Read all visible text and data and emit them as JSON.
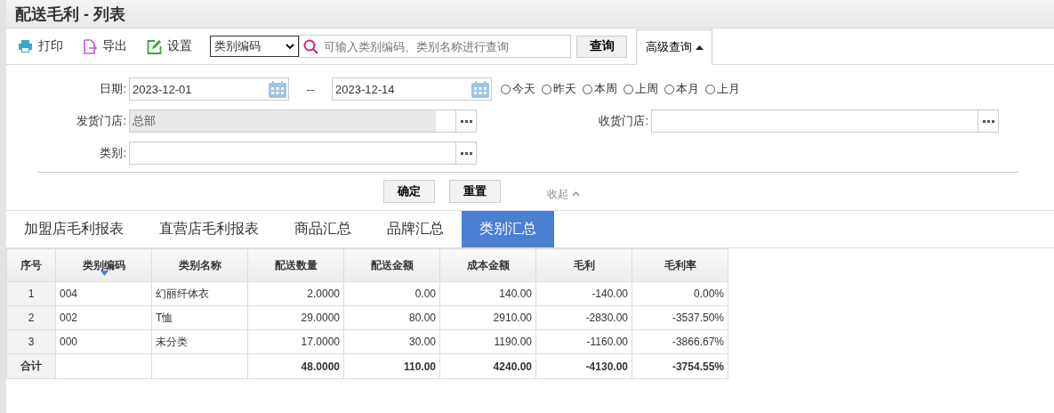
{
  "title": "配送毛利 - 列表",
  "toolbar": {
    "actions": [
      {
        "kind": "print",
        "label": "打印"
      },
      {
        "kind": "export",
        "label": "导出"
      },
      {
        "kind": "settings",
        "label": "设置"
      }
    ],
    "search_type": "类别编码",
    "search": {
      "placeholder": "可输入类别编码、类别名称进行查询"
    },
    "search_button": "查询",
    "advanced": {
      "label": "高级查询",
      "expanded": true
    }
  },
  "filters": {
    "date": {
      "label": "日期:",
      "from": "2023-12-01",
      "separator": "--",
      "to": "2023-12-14"
    },
    "quick_dates": [
      {
        "label": "今天",
        "selected": false
      },
      {
        "label": "昨天",
        "selected": false
      },
      {
        "label": "本周",
        "selected": false
      },
      {
        "label": "上周",
        "selected": false
      },
      {
        "label": "本月",
        "selected": false
      },
      {
        "label": "上月",
        "selected": false
      }
    ],
    "ship_store": {
      "label": "发货门店:",
      "value": "总部",
      "disabled": true
    },
    "receive_store": {
      "label": "收货门店:",
      "disabled": false
    },
    "category": {
      "label": "类别:",
      "disabled": false
    },
    "buttons": [
      "确定",
      "重置"
    ],
    "collapse": "收起"
  },
  "tabs": [
    {
      "label": "加盟店毛利报表",
      "selected": false
    },
    {
      "label": "直营店毛利报表",
      "selected": false
    },
    {
      "label": "商品汇总",
      "selected": false
    },
    {
      "label": "品牌汇总",
      "selected": false
    },
    {
      "label": "类别汇总",
      "selected": true
    }
  ],
  "table": {
    "columns": [
      {
        "label": "序号",
        "kind": "index",
        "sorted": false
      },
      {
        "label": "类别编码",
        "kind": "text",
        "sorted": true
      },
      {
        "label": "类别名称",
        "kind": "text",
        "sorted": false
      },
      {
        "label": "配送数量",
        "kind": "number",
        "sorted": false
      },
      {
        "label": "配送金额",
        "kind": "number",
        "sorted": false
      },
      {
        "label": "成本金额",
        "kind": "number",
        "sorted": false
      },
      {
        "label": "毛利",
        "kind": "number",
        "sorted": false
      },
      {
        "label": "毛利率",
        "kind": "number",
        "sorted": false
      }
    ],
    "rows": [
      [
        "1",
        "004",
        "幻丽纤体衣",
        "2.0000",
        "0.00",
        "140.00",
        "-140.00",
        "0.00%"
      ],
      [
        "2",
        "002",
        "T恤",
        "29.0000",
        "80.00",
        "2910.00",
        "-2830.00",
        "-3537.50%"
      ],
      [
        "3",
        "000",
        "未分类",
        "17.0000",
        "30.00",
        "1190.00",
        "-1160.00",
        "-3866.67%"
      ]
    ],
    "total": {
      "label": "合计",
      "values": [
        "48.0000",
        "110.00",
        "4240.00",
        "-4130.00",
        "-3754.55%"
      ]
    }
  }
}
